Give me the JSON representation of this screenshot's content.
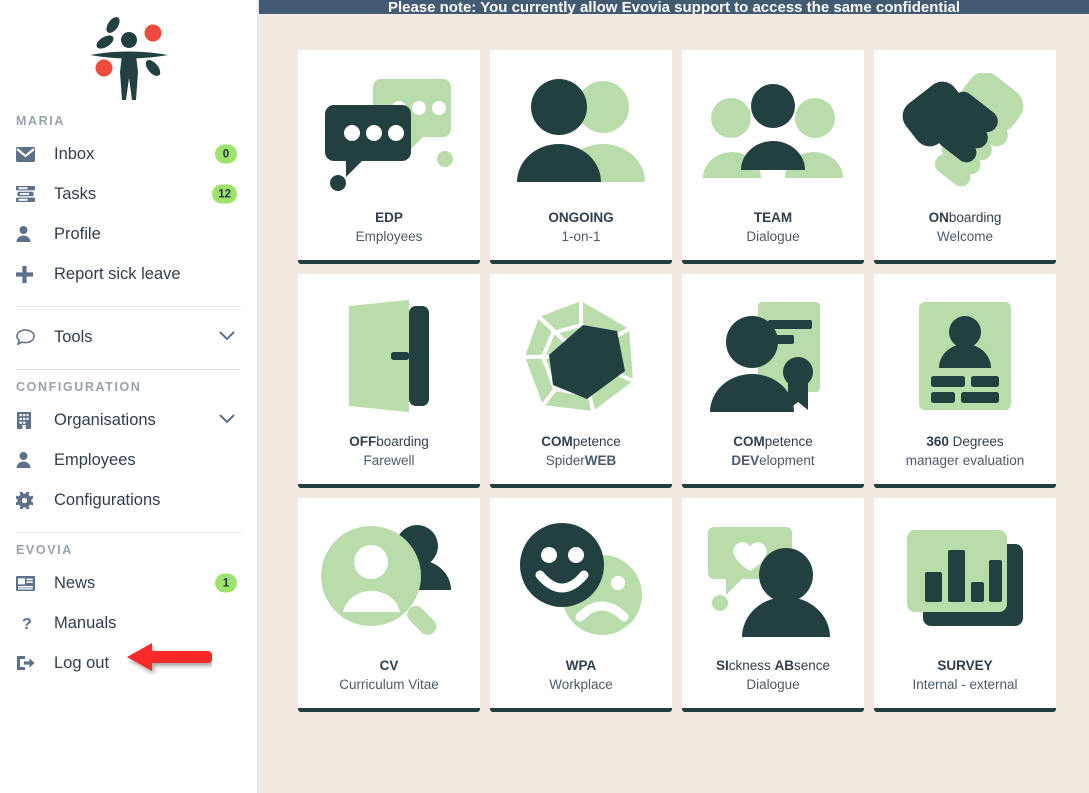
{
  "notice": {
    "text": "Please note: You currently allow Evovia support to access the same confidential"
  },
  "sidebar": {
    "logo_name": "evovia-logo",
    "sections": [
      {
        "label": "MARIA",
        "items": [
          {
            "icon": "envelope-icon",
            "label": "Inbox",
            "badge": "0"
          },
          {
            "icon": "tasks-list-icon",
            "label": "Tasks",
            "badge": "12"
          },
          {
            "icon": "user-icon",
            "label": "Profile",
            "badge": null
          },
          {
            "icon": "plus-icon",
            "label": "Report sick leave",
            "badge": null
          }
        ]
      },
      {
        "label": "",
        "items": [
          {
            "icon": "chat-bubble-icon",
            "label": "Tools",
            "badge": null,
            "chevron": true
          }
        ]
      },
      {
        "label": "CONFIGURATION",
        "items": [
          {
            "icon": "building-icon",
            "label": "Organisations",
            "badge": null,
            "chevron": true
          },
          {
            "icon": "user-icon",
            "label": "Employees",
            "badge": null
          },
          {
            "icon": "gear-icon",
            "label": "Configurations",
            "badge": null
          }
        ]
      },
      {
        "label": "EVOVIA",
        "items": [
          {
            "icon": "news-icon",
            "label": "News",
            "badge": "1"
          },
          {
            "icon": "question-mark-icon",
            "label": "Manuals",
            "badge": null
          },
          {
            "icon": "logout-icon",
            "label": "Log out",
            "badge": null
          }
        ]
      }
    ]
  },
  "cards": [
    {
      "icon": "speech-bubbles-icon",
      "title_bold": "EDP",
      "title_rest": "",
      "sub_plain": "Employees",
      "sub_bold": ""
    },
    {
      "icon": "two-people-icon",
      "title_bold": "ONGOING",
      "title_rest": "",
      "sub_plain": "1-on-1",
      "sub_bold": ""
    },
    {
      "icon": "three-people-icon",
      "title_bold": "TEAM",
      "title_rest": "",
      "sub_plain": "Dialogue",
      "sub_bold": ""
    },
    {
      "icon": "handshake-icon",
      "title_bold": "ON",
      "title_rest": "boarding",
      "sub_plain": "Welcome",
      "sub_bold": ""
    },
    {
      "icon": "door-icon",
      "title_bold": "OFF",
      "title_rest": "boarding",
      "sub_plain": "Farewell",
      "sub_bold": ""
    },
    {
      "icon": "spiderweb-chart-icon",
      "title_bold": "COM",
      "title_rest": "petence",
      "sub_plain": "Spider",
      "sub_bold": "WEB"
    },
    {
      "icon": "person-certificate-icon",
      "title_bold": "COM",
      "title_rest": "petence",
      "sub_plain": "",
      "sub_bold": "DEV",
      "sub_rest": "elopment"
    },
    {
      "icon": "id-card-icon",
      "title_bold": "360",
      "title_rest": " Degrees",
      "sub_plain": "manager evaluation",
      "sub_bold": ""
    },
    {
      "icon": "person-magnifier-icon",
      "title_bold": "CV",
      "title_rest": "",
      "sub_plain": "Curriculum Vitae",
      "sub_bold": ""
    },
    {
      "icon": "happy-sad-faces-icon",
      "title_bold": "WPA",
      "title_rest": "",
      "sub_plain": "Workplace",
      "sub_bold": ""
    },
    {
      "icon": "heart-bubble-person-icon",
      "title_bold": "SI",
      "title_rest": "ckness ",
      "title_bold2": "AB",
      "title_rest2": "sence",
      "sub_plain": "Dialogue",
      "sub_bold": ""
    },
    {
      "icon": "bar-chart-icon",
      "title_bold": "SURVEY",
      "title_rest": "",
      "sub_plain": "Internal - external",
      "sub_bold": ""
    }
  ],
  "annotation": {
    "arrow": "red-left-arrow",
    "points_at": "Manuals"
  },
  "colors": {
    "brand_dark": "#22403f",
    "brand_light_green": "#b9dcab",
    "content_bg": "#f2eae0",
    "notice_bar": "#425a72",
    "badge_green": "#9de26b",
    "accent_red": "#ef4b3c",
    "annotation_red": "#fb2b2b",
    "icon_slate": "#5c7089",
    "text_dark": "#2f3e4e"
  }
}
